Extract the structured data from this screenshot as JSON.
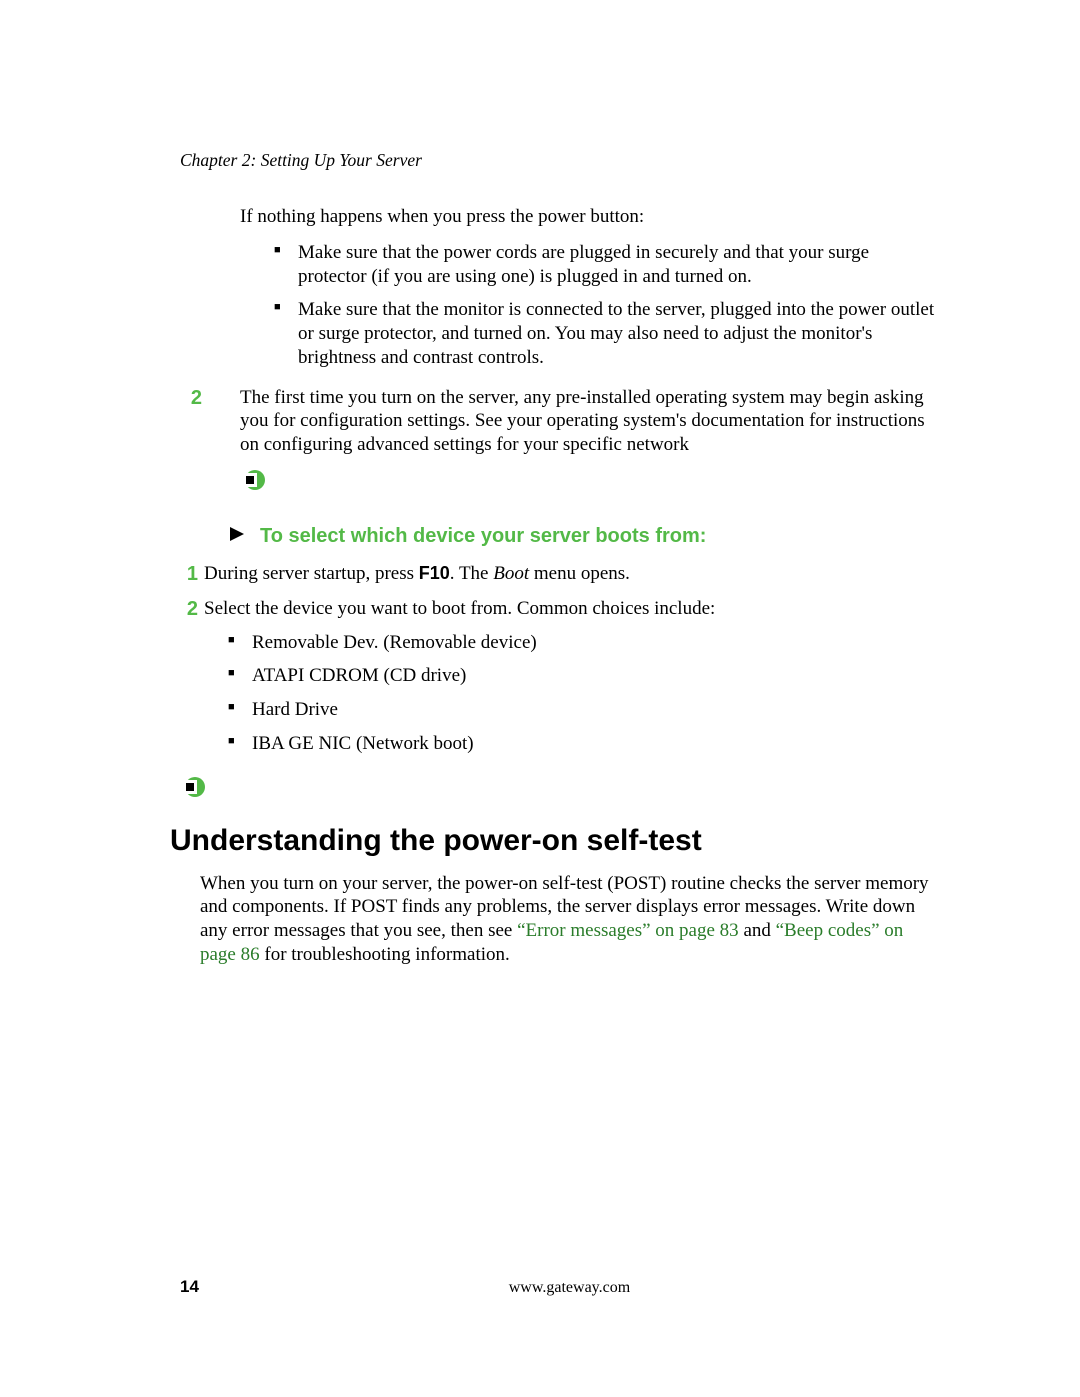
{
  "header": {
    "chapter": "Chapter 2: Setting Up Your Server"
  },
  "intro": {
    "lead": "If nothing happens when you press the power button:",
    "bullets": [
      "Make sure that the power cords are plugged in securely and that your surge protector (if you are using one) is plugged in and turned on.",
      "Make sure that the monitor is connected to the server, plugged into the power outlet or surge protector, and turned on. You may also need to adjust the monitor's brightness and contrast controls."
    ]
  },
  "step2": {
    "num": "2",
    "text": "The first time you turn on the server, any pre-installed operating system may begin asking you for configuration settings. See your operating system's documentation for instructions on configuring advanced settings for your specific network"
  },
  "procedure": {
    "heading": "To select which device your server boots from:",
    "steps": [
      {
        "num": "1",
        "pre": "During server startup, press ",
        "key": "F10",
        "mid": ". The ",
        "menu": "Boot",
        "post": " menu opens."
      },
      {
        "num": "2",
        "text": "Select the device you want to boot from. Common choices include:",
        "bullets": [
          "Removable Dev. (Removable device)",
          "ATAPI CDROM (CD drive)",
          "Hard Drive",
          "IBA GE NIC (Network boot)"
        ]
      }
    ]
  },
  "section": {
    "title": "Understanding the power-on self-test",
    "p_pre": "When you turn on your server, the power-on self-test (POST) routine checks the server memory and components. If POST finds any problems, the server displays error messages. Write down any error messages that you see, then see ",
    "xref1": "“Error messages” on page 83",
    "and": " and ",
    "xref2": "“Beep codes” on page 86",
    "p_post": " for troubleshooting information."
  },
  "footer": {
    "page": "14",
    "url": "www.gateway.com"
  }
}
